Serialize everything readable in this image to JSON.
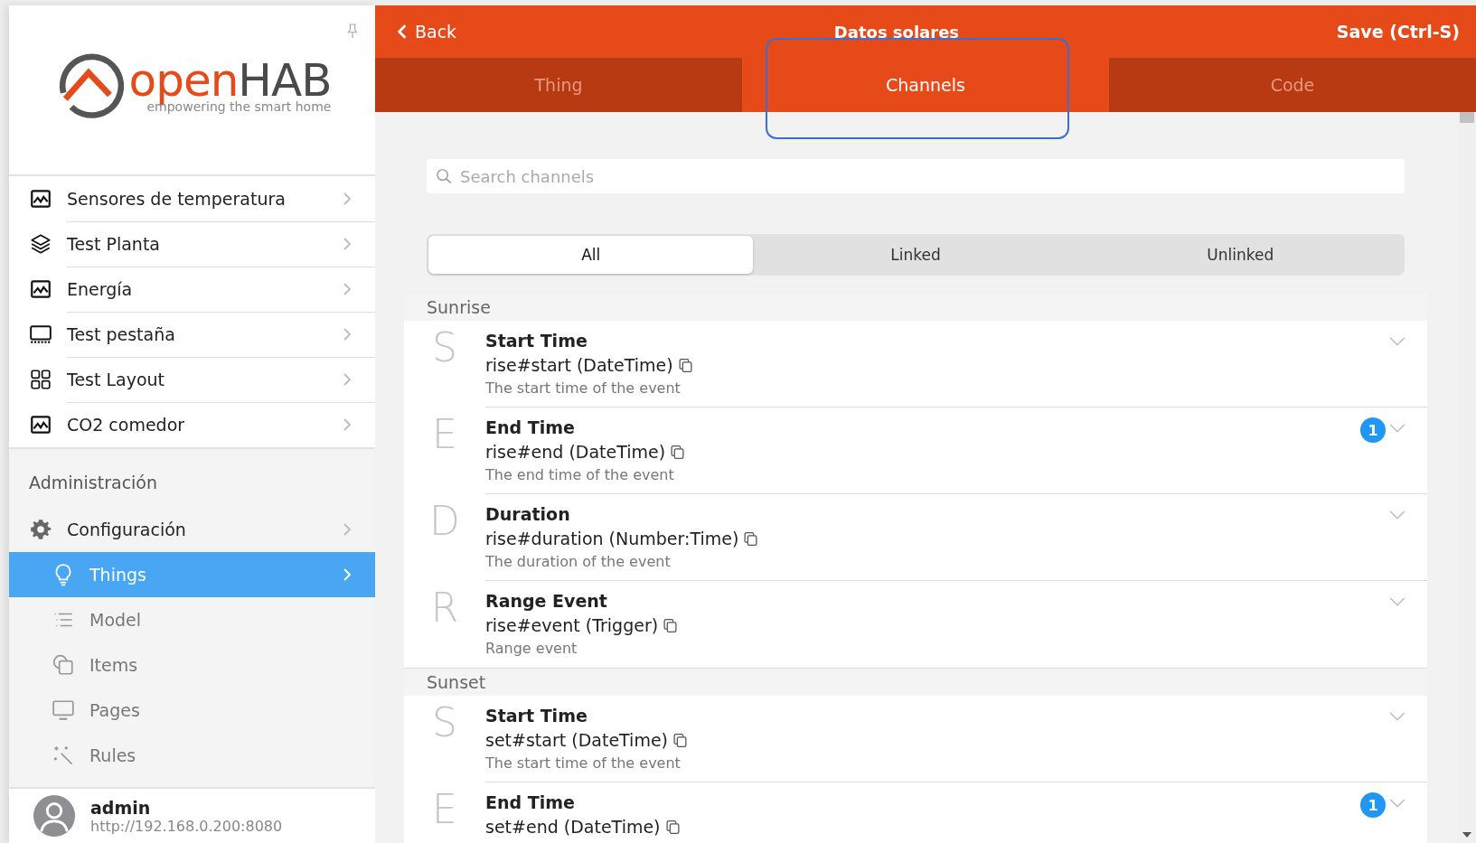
{
  "sidebar": {
    "logo": {
      "word_1": "open",
      "word_2": "HAB",
      "tagline": "empowering the smart home"
    },
    "pages": [
      {
        "label": "Sensores de temperatura",
        "kind": "chart"
      },
      {
        "label": "Test Planta",
        "kind": "layers"
      },
      {
        "label": "Energía",
        "kind": "chart"
      },
      {
        "label": "Test pestaña",
        "kind": "tabs"
      },
      {
        "label": "Test Layout",
        "kind": "grid"
      },
      {
        "label": "CO2 comedor",
        "kind": "chart"
      }
    ],
    "admin": {
      "heading": "Administración",
      "items": [
        {
          "label": "Configuración",
          "kind": "gear",
          "selected": false,
          "children": [
            {
              "label": "Things",
              "kind": "bulb",
              "selected": true
            },
            {
              "label": "Model",
              "kind": "list",
              "selected": false
            },
            {
              "label": "Items",
              "kind": "items",
              "selected": false
            },
            {
              "label": "Pages",
              "kind": "monitor",
              "selected": false
            },
            {
              "label": "Rules",
              "kind": "wand",
              "selected": false
            }
          ]
        }
      ]
    },
    "user": {
      "name": "admin",
      "url": "http://192.168.0.200:8080"
    }
  },
  "header": {
    "back": "Back",
    "title": "Datos solares",
    "save": "Save (Ctrl-S)"
  },
  "tabs": [
    {
      "label": "Thing",
      "selected": false,
      "highlighted": false
    },
    {
      "label": "Channels",
      "selected": true,
      "highlighted": true
    },
    {
      "label": "Code",
      "selected": false,
      "highlighted": false
    }
  ],
  "search": {
    "placeholder": "Search channels"
  },
  "filters": [
    {
      "label": "All",
      "selected": true
    },
    {
      "label": "Linked",
      "selected": false
    },
    {
      "label": "Unlinked",
      "selected": false
    }
  ],
  "groups": [
    {
      "title": "Sunrise",
      "channels": [
        {
          "initial": "S",
          "label": "Start Time",
          "channel": "rise#start (DateTime)",
          "description": "The start time of the event"
        },
        {
          "initial": "E",
          "label": "End Time",
          "channel": "rise#end (DateTime)",
          "description": "The end time of the event",
          "badge": "1"
        },
        {
          "initial": "D",
          "label": "Duration",
          "channel": "rise#duration (Number:Time)",
          "description": "The duration of the event"
        },
        {
          "initial": "R",
          "label": "Range Event",
          "channel": "rise#event (Trigger)",
          "description": "Range event"
        }
      ]
    },
    {
      "title": "Sunset",
      "channels": [
        {
          "initial": "S",
          "label": "Start Time",
          "channel": "set#start (DateTime)",
          "description": "The start time of the event"
        },
        {
          "initial": "E",
          "label": "End Time",
          "channel": "set#end (DateTime)",
          "badge": "1"
        }
      ]
    }
  ]
}
